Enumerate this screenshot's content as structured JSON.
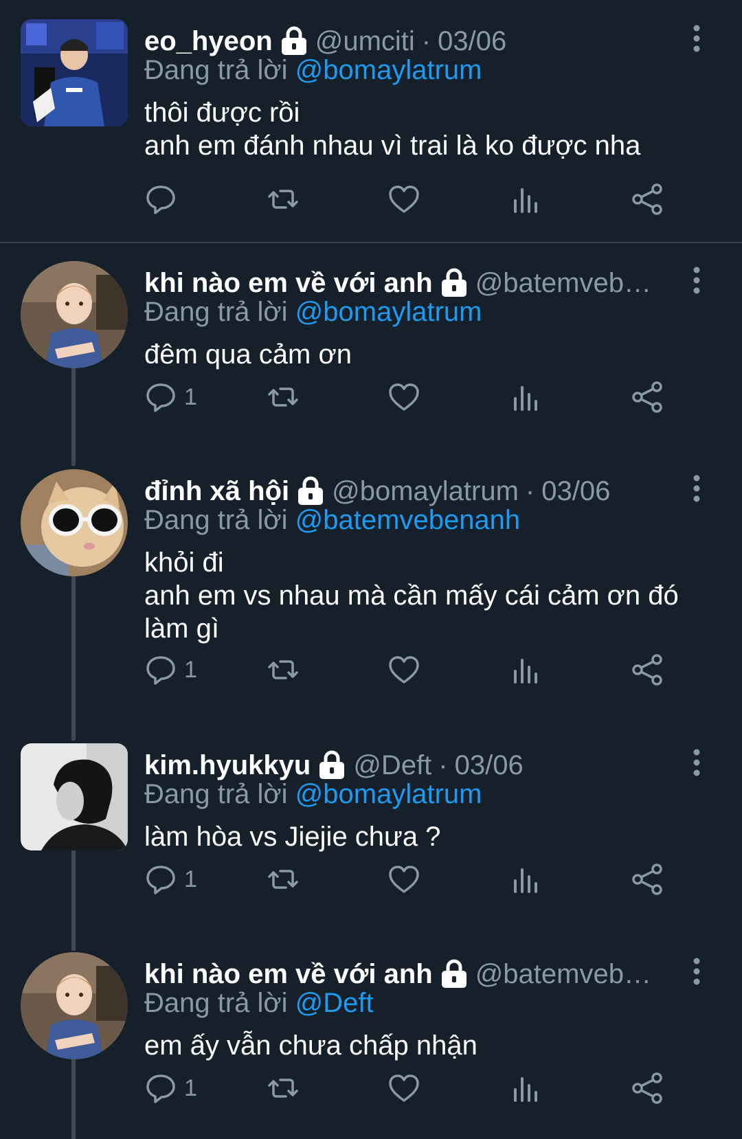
{
  "colors": {
    "background": "#15202b",
    "muted_text": "#8b98a5",
    "mention": "#1d9bf0",
    "thread_line": "#3d4a56"
  },
  "icons": {
    "reply": "speech-bubble-icon",
    "retweet": "retweet-arrows-icon",
    "like": "heart-icon",
    "views": "bar-chart-icon",
    "share": "share-icon",
    "more": "vertical-dots-icon",
    "protected": "lock-icon"
  },
  "tweets": [
    {
      "display_name": "eo_hyeon",
      "handle": "@umciti",
      "dot": "·",
      "date": "03/06",
      "reply_prefix": "Đang trả lời",
      "reply_to": "@bomaylatrum",
      "text": "thôi được rồi\nanh em đánh nhau vì trai là ko được nha",
      "reply_count": ""
    },
    {
      "display_name": "khi nào em về với anh",
      "handle": "@batemveben...",
      "dot": "",
      "date": "",
      "reply_prefix": "Đang trả lời",
      "reply_to": "@bomaylatrum",
      "text": "đêm qua cảm ơn",
      "reply_count": "1"
    },
    {
      "display_name": "đỉnh xã hội",
      "handle": "@bomaylatrum",
      "dot": "·",
      "date": "03/06",
      "reply_prefix": "Đang trả lời",
      "reply_to": "@batemvebenanh",
      "text": "khỏi đi\nanh em vs nhau mà cần mấy cái cảm ơn đó\nlàm gì",
      "reply_count": "1"
    },
    {
      "display_name": "kim.hyukkyu",
      "handle": "@Deft",
      "dot": "·",
      "date": "03/06",
      "reply_prefix": "Đang trả lời",
      "reply_to": "@bomaylatrum",
      "text": "làm hòa vs Jiejie chưa ?",
      "reply_count": "1"
    },
    {
      "display_name": "khi nào em về với anh",
      "handle": "@batemveben...",
      "dot": "",
      "date": "",
      "reply_prefix": "Đang trả lời",
      "reply_to": "@Deft",
      "text": "em ấy vẫn chưa chấp nhận",
      "reply_count": "1"
    }
  ]
}
